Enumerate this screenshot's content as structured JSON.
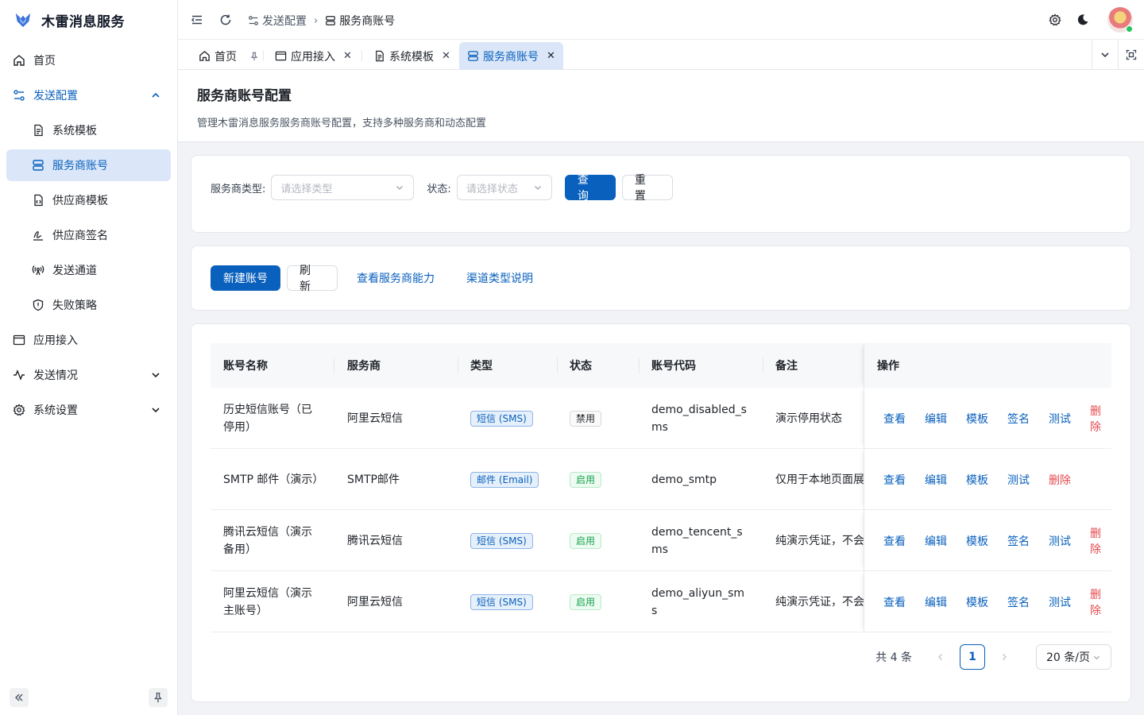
{
  "app": {
    "name": "木雷消息服务"
  },
  "sidebar": {
    "items": [
      {
        "label": "首页",
        "icon": "home-icon"
      },
      {
        "label": "发送配置",
        "icon": "config-icon"
      },
      {
        "label": "系统模板",
        "icon": "document-icon"
      },
      {
        "label": "服务商账号",
        "icon": "server-icon"
      },
      {
        "label": "供应商模板",
        "icon": "file-code-icon"
      },
      {
        "label": "供应商签名",
        "icon": "signature-icon"
      },
      {
        "label": "发送通道",
        "icon": "broadcast-icon"
      },
      {
        "label": "失败策略",
        "icon": "shield-icon"
      },
      {
        "label": "应用接入",
        "icon": "app-window-icon"
      },
      {
        "label": "发送情况",
        "icon": "activity-icon"
      },
      {
        "label": "系统设置",
        "icon": "gear-icon"
      }
    ]
  },
  "header": {
    "breadcrumb": [
      "发送配置",
      "服务商账号"
    ]
  },
  "tabs": [
    {
      "label": "首页"
    },
    {
      "label": "应用接入"
    },
    {
      "label": "系统模板"
    },
    {
      "label": "服务商账号"
    }
  ],
  "page": {
    "title": "服务商账号配置",
    "description": "管理木雷消息服务服务商账号配置，支持多种服务商和动态配置"
  },
  "filters": {
    "type_label": "服务商类型",
    "type_placeholder": "请选择类型",
    "status_label": "状态",
    "status_placeholder": "请选择状态",
    "query_button": "查询",
    "reset_button": "重置"
  },
  "toolbar": {
    "new_button": "新建账号",
    "refresh_button": "刷新",
    "capability_link": "查看服务商能力",
    "channel_link": "渠道类型说明"
  },
  "table": {
    "columns": [
      "账号名称",
      "服务商",
      "类型",
      "状态",
      "账号代码",
      "备注",
      "操作"
    ],
    "rows": [
      {
        "name": "历史短信账号（已停用）",
        "provider": "阿里云短信",
        "type": "短信 (SMS)",
        "status": "禁用",
        "code": "demo_disabled_sms",
        "remark": "演示停用状态",
        "actions": [
          "查看",
          "编辑",
          "模板",
          "签名",
          "测试",
          "删除"
        ]
      },
      {
        "name": "SMTP 邮件（演示）",
        "provider": "SMTP邮件",
        "type": "邮件 (Email)",
        "status": "启用",
        "code": "demo_smtp",
        "remark": "仅用于本地页面展",
        "actions": [
          "查看",
          "编辑",
          "模板",
          "测试",
          "删除"
        ]
      },
      {
        "name": "腾讯云短信（演示备用）",
        "provider": "腾讯云短信",
        "type": "短信 (SMS)",
        "status": "启用",
        "code": "demo_tencent_sms",
        "remark": "纯演示凭证，不会",
        "actions": [
          "查看",
          "编辑",
          "模板",
          "签名",
          "测试",
          "删除"
        ]
      },
      {
        "name": "阿里云短信（演示主账号）",
        "provider": "阿里云短信",
        "type": "短信 (SMS)",
        "status": "启用",
        "code": "demo_aliyun_sms",
        "remark": "纯演示凭证，不会",
        "actions": [
          "查看",
          "编辑",
          "模板",
          "签名",
          "测试",
          "删除"
        ]
      }
    ]
  },
  "pagination": {
    "total_text": "共 4 条",
    "current_page": "1",
    "page_size": "20 条/页"
  },
  "colors": {
    "primary": "#0960bd",
    "danger": "#e5484d",
    "success": "#16a34a"
  }
}
